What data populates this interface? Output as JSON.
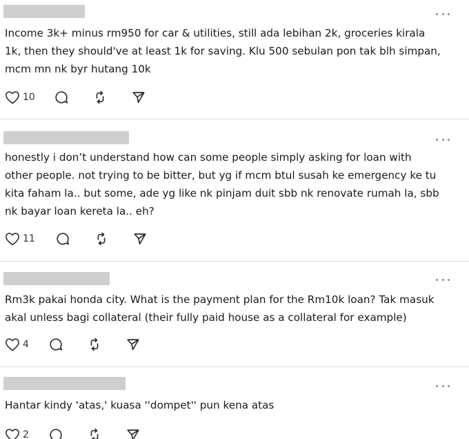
{
  "posts": [
    {
      "text": "Income 3k+ minus rm950 for car & utilities, still ada lebihan 2k, groceries kirala\n1k, then they should've at least 1k for saving. Klu 500 sebulan pon tak blh simpan,\nmcm mn nk byr hutang 10k",
      "likes": "10"
    },
    {
      "text": "honestly i don’t understand how can some people simply asking for loan with\nother people. not trying to be bitter, but yg if mcm btul susah ke emergency ke tu\nkita faham la.. but some, ade yg like nk pinjam duit sbb nk renovate rumah la, sbb\nnk bayar loan kereta la.. eh?",
      "likes": "11"
    },
    {
      "text": "Rm3k pakai honda city. What is the payment plan for the Rm10k loan? Tak masuk\nakal unless bagi collateral (their fully paid house as a collateral for example)",
      "likes": "4"
    },
    {
      "text": "Hantar kindy 'atas,' kuasa ''dompet'' pun kena atas",
      "likes": "2"
    }
  ],
  "icons": {
    "like": "heart-icon",
    "reply": "reply-bubble-icon",
    "repost": "repost-icon",
    "share": "share-send-icon",
    "more": "more-options-icon"
  },
  "colors": {
    "redaction": "#cfcfcf",
    "divider": "#dcdcdc",
    "icon": "#2a2a2a"
  }
}
